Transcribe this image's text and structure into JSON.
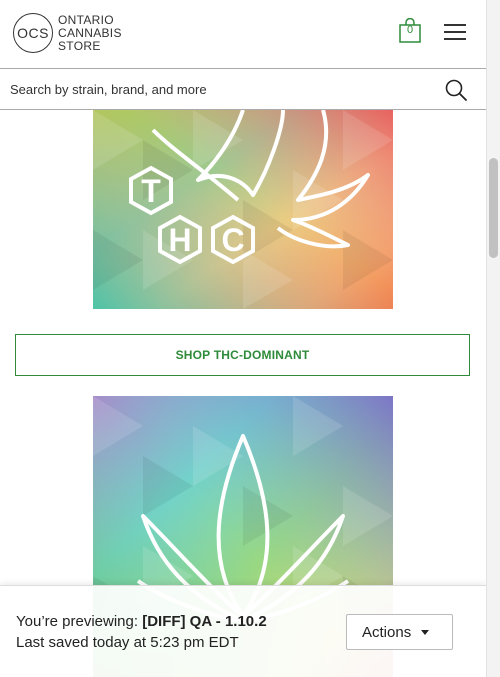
{
  "header": {
    "logo_initials": "OCS",
    "logo_lines": [
      "ONTARIO",
      "CANNABIS",
      "STORE"
    ],
    "cart_count": "0",
    "cart_icon": "shopping-bag-icon",
    "menu_icon": "hamburger-menu-icon"
  },
  "search": {
    "placeholder": "Search by strain, brand, and more",
    "icon": "search-icon"
  },
  "banners": {
    "thc_letters": [
      "T",
      "H",
      "C"
    ],
    "shop_button_label": "SHOP THC-DOMINANT"
  },
  "preview": {
    "prefix": "You’re previewing: ",
    "version": "[DIFF] QA - 1.10.2",
    "saved": "Last saved today at 5:23 pm EDT",
    "actions_label": "Actions"
  },
  "colors": {
    "brand_green": "#2e8b3a"
  }
}
